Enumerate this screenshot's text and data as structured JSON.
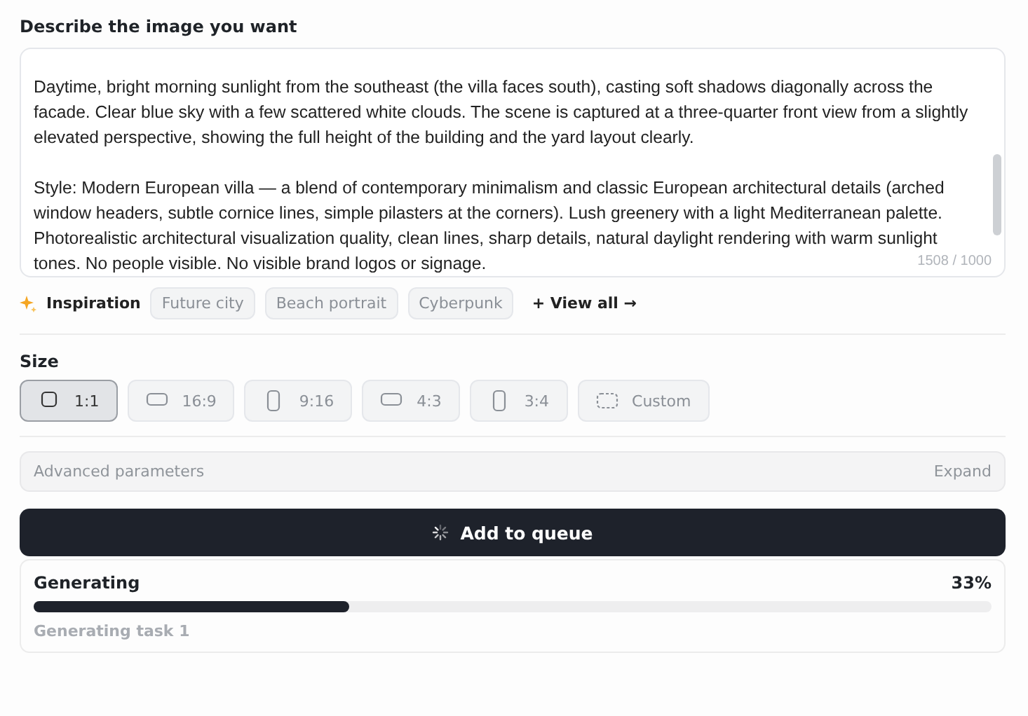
{
  "prompt": {
    "label": "Describe the image you want",
    "value": "\nDaytime, bright morning sunlight from the southeast (the villa faces south), casting soft shadows diagonally across the facade. Clear blue sky with a few scattered white clouds. The scene is captured at a three-quarter front view from a slightly elevated perspective, showing the full height of the building and the yard layout clearly.\n\nStyle: Modern European villa — a blend of contemporary minimalism and classic European architectural details (arched window headers, subtle cornice lines, simple pilasters at the corners). Lush greenery with a light Mediterranean palette. Photorealistic architectural visualization quality, clean lines, sharp details, natural daylight rendering with warm sunlight tones. No people visible. No visible brand logos or signage.",
    "counter": "1508 / 1000"
  },
  "inspiration": {
    "label": "Inspiration",
    "chips": [
      "Future city",
      "Beach portrait",
      "Cyberpunk"
    ],
    "view_all": "+ View all →"
  },
  "size": {
    "label": "Size",
    "options": [
      {
        "label": "1:1",
        "kind": "square",
        "selected": true
      },
      {
        "label": "16:9",
        "kind": "wide",
        "selected": false
      },
      {
        "label": "9:16",
        "kind": "tall",
        "selected": false
      },
      {
        "label": "4:3",
        "kind": "wide",
        "selected": false
      },
      {
        "label": "3:4",
        "kind": "tall",
        "selected": false
      },
      {
        "label": "Custom",
        "kind": "custom",
        "selected": false
      }
    ]
  },
  "advanced": {
    "label": "Advanced parameters",
    "action": "Expand"
  },
  "submit": {
    "label": "Add to queue"
  },
  "progress": {
    "title": "Generating",
    "percent": "33%",
    "level": 0.33,
    "task": "Generating task 1"
  }
}
